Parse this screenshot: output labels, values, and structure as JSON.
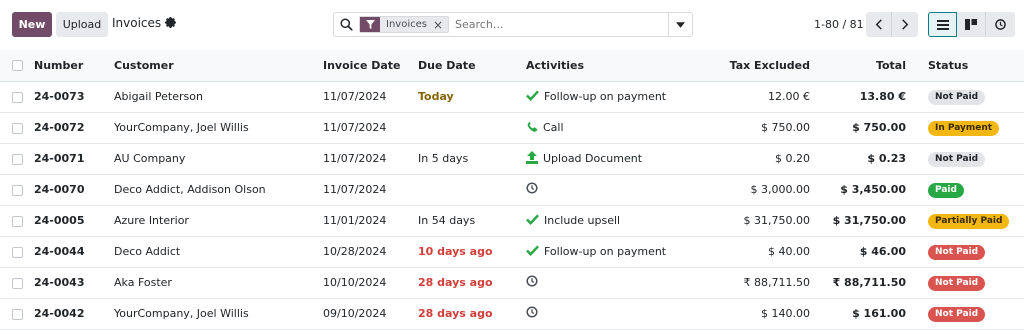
{
  "toolbar": {
    "new_label": "New",
    "upload_label": "Upload",
    "title": "Invoices"
  },
  "search": {
    "facet_label": "Invoices",
    "placeholder": "Search..."
  },
  "pager": {
    "text": "1-80 / 81"
  },
  "colors": {
    "brand": "#714B67",
    "late": "#d23f3a",
    "today": "#856404",
    "badge_paid": "#28a745",
    "badge_warning": "#f3b712",
    "badge_danger": "#d9534f"
  },
  "table": {
    "headers": {
      "number": "Number",
      "customer": "Customer",
      "invoice_date": "Invoice Date",
      "due_date": "Due Date",
      "activities": "Activities",
      "tax_excluded": "Tax Excluded",
      "total": "Total",
      "status": "Status"
    },
    "rows": [
      {
        "number": "24-0073",
        "customer": "Abigail Peterson",
        "invoice_date": "11/07/2024",
        "due_date": "Today",
        "due_style": "today",
        "activity_icon": "check-icon",
        "activity": "Follow-up on payment",
        "tax_excluded": "12.00 €",
        "total": "13.80 €",
        "status": "Not Paid",
        "status_style": "notpaid"
      },
      {
        "number": "24-0072",
        "customer": "YourCompany, Joel Willis",
        "invoice_date": "11/07/2024",
        "due_date": "",
        "due_style": "",
        "activity_icon": "phone-icon",
        "activity": "Call",
        "tax_excluded": "$ 750.00",
        "total": "$ 750.00",
        "status": "In Payment",
        "status_style": "inpay"
      },
      {
        "number": "24-0071",
        "customer": "AU Company",
        "invoice_date": "11/07/2024",
        "due_date": "In 5 days",
        "due_style": "",
        "activity_icon": "upload-icon",
        "activity": "Upload Document",
        "tax_excluded": "$ 0.20",
        "total": "$ 0.23",
        "status": "Not Paid",
        "status_style": "notpaid"
      },
      {
        "number": "24-0070",
        "customer": "Deco Addict, Addison Olson",
        "invoice_date": "11/07/2024",
        "due_date": "",
        "due_style": "",
        "activity_icon": "clock-icon",
        "activity": "",
        "tax_excluded": "$ 3,000.00",
        "total": "$ 3,450.00",
        "status": "Paid",
        "status_style": "paid"
      },
      {
        "number": "24-0005",
        "customer": "Azure Interior",
        "invoice_date": "11/01/2024",
        "due_date": "In 54 days",
        "due_style": "",
        "activity_icon": "check-icon",
        "activity": "Include upsell",
        "tax_excluded": "$ 31,750.00",
        "total": "$ 31,750.00",
        "status": "Partially Paid",
        "status_style": "partial"
      },
      {
        "number": "24-0044",
        "customer": "Deco Addict",
        "invoice_date": "10/28/2024",
        "due_date": "10 days ago",
        "due_style": "late",
        "activity_icon": "check-icon",
        "activity": "Follow-up on payment",
        "tax_excluded": "$ 40.00",
        "total": "$ 46.00",
        "status": "Not Paid",
        "status_style": "notpaid-red"
      },
      {
        "number": "24-0043",
        "customer": "Aka Foster",
        "invoice_date": "10/10/2024",
        "due_date": "28 days ago",
        "due_style": "late",
        "activity_icon": "clock-icon",
        "activity": "",
        "tax_excluded": "₹ 88,711.50",
        "total": "₹ 88,711.50",
        "status": "Not Paid",
        "status_style": "notpaid-red"
      },
      {
        "number": "24-0042",
        "customer": "YourCompany, Joel Willis",
        "invoice_date": "09/10/2024",
        "due_date": "28 days ago",
        "due_style": "late",
        "activity_icon": "clock-icon",
        "activity": "",
        "tax_excluded": "$ 140.00",
        "total": "$ 161.00",
        "status": "Not Paid",
        "status_style": "notpaid-red"
      }
    ]
  }
}
